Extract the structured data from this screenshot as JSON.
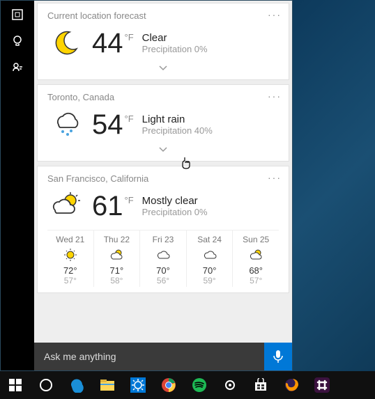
{
  "cards": [
    {
      "title": "Current location forecast",
      "temp": "44",
      "unit": "°F",
      "condition": "Clear",
      "precip": "Precipitation 0%",
      "icon": "moon"
    },
    {
      "title": "Toronto, Canada",
      "temp": "54",
      "unit": "°F",
      "condition": "Light rain",
      "precip": "Precipitation 40%",
      "icon": "rain"
    },
    {
      "title": "San Francisco, California",
      "temp": "61",
      "unit": "°F",
      "condition": "Mostly clear",
      "precip": "Precipitation 0%",
      "icon": "partly"
    }
  ],
  "forecast": [
    {
      "day": "Wed 21",
      "icon": "sunny",
      "hi": "72°",
      "lo": "57°"
    },
    {
      "day": "Thu 22",
      "icon": "partly",
      "hi": "71°",
      "lo": "58°"
    },
    {
      "day": "Fri 23",
      "icon": "cloudy",
      "hi": "70°",
      "lo": "56°"
    },
    {
      "day": "Sat 24",
      "icon": "cloudy",
      "hi": "70°",
      "lo": "59°"
    },
    {
      "day": "Sun 25",
      "icon": "partly",
      "hi": "68°",
      "lo": "57°"
    }
  ],
  "search": {
    "placeholder": "Ask me anything"
  },
  "more_glyph": "···",
  "colors": {
    "accent": "#0078d7"
  }
}
